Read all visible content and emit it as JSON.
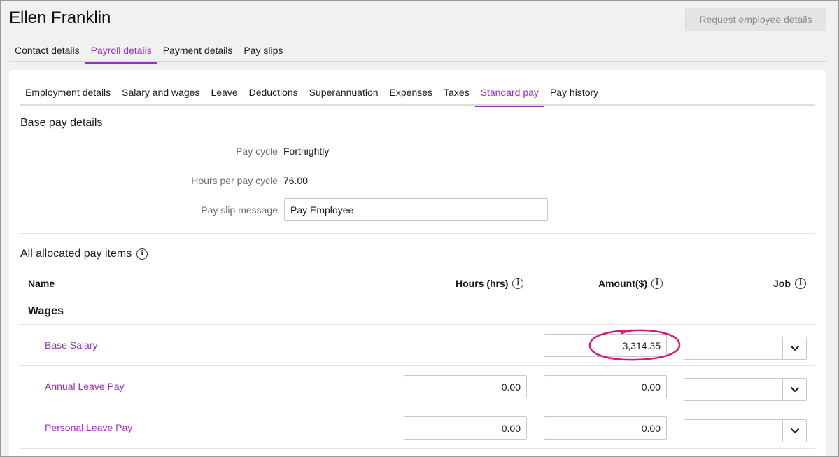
{
  "employee": {
    "name": "Ellen Franklin"
  },
  "header": {
    "request_button": "Request employee details"
  },
  "top_tabs": [
    {
      "label": "Contact details",
      "active": false
    },
    {
      "label": "Payroll details",
      "active": true
    },
    {
      "label": "Payment details",
      "active": false
    },
    {
      "label": "Pay slips",
      "active": false
    }
  ],
  "sub_tabs": [
    {
      "label": "Employment details",
      "active": false
    },
    {
      "label": "Salary and wages",
      "active": false
    },
    {
      "label": "Leave",
      "active": false
    },
    {
      "label": "Deductions",
      "active": false
    },
    {
      "label": "Superannuation",
      "active": false
    },
    {
      "label": "Expenses",
      "active": false
    },
    {
      "label": "Taxes",
      "active": false
    },
    {
      "label": "Standard pay",
      "active": true
    },
    {
      "label": "Pay history",
      "active": false
    }
  ],
  "base_pay": {
    "title": "Base pay details",
    "pay_cycle_label": "Pay cycle",
    "pay_cycle_value": "Fortnightly",
    "hours_label": "Hours per pay cycle",
    "hours_value": "76.00",
    "message_label": "Pay slip message",
    "message_value": "Pay Employee"
  },
  "pay_items": {
    "title": "All allocated pay items",
    "columns": {
      "name": "Name",
      "hours": "Hours (hrs)",
      "amount": "Amount($)",
      "job": "Job"
    },
    "group": "Wages",
    "rows": [
      {
        "name": "Base Salary",
        "hours": null,
        "amount": "3,314.35",
        "job": ""
      },
      {
        "name": "Annual Leave Pay",
        "hours": "0.00",
        "amount": "0.00",
        "job": ""
      },
      {
        "name": "Personal Leave Pay",
        "hours": "0.00",
        "amount": "0.00",
        "job": ""
      }
    ]
  },
  "colors": {
    "accent": "#9b2fbf",
    "highlight": "#d6177a"
  },
  "icons": {
    "info": "info-icon",
    "dropdown": "chevron-down-icon"
  }
}
